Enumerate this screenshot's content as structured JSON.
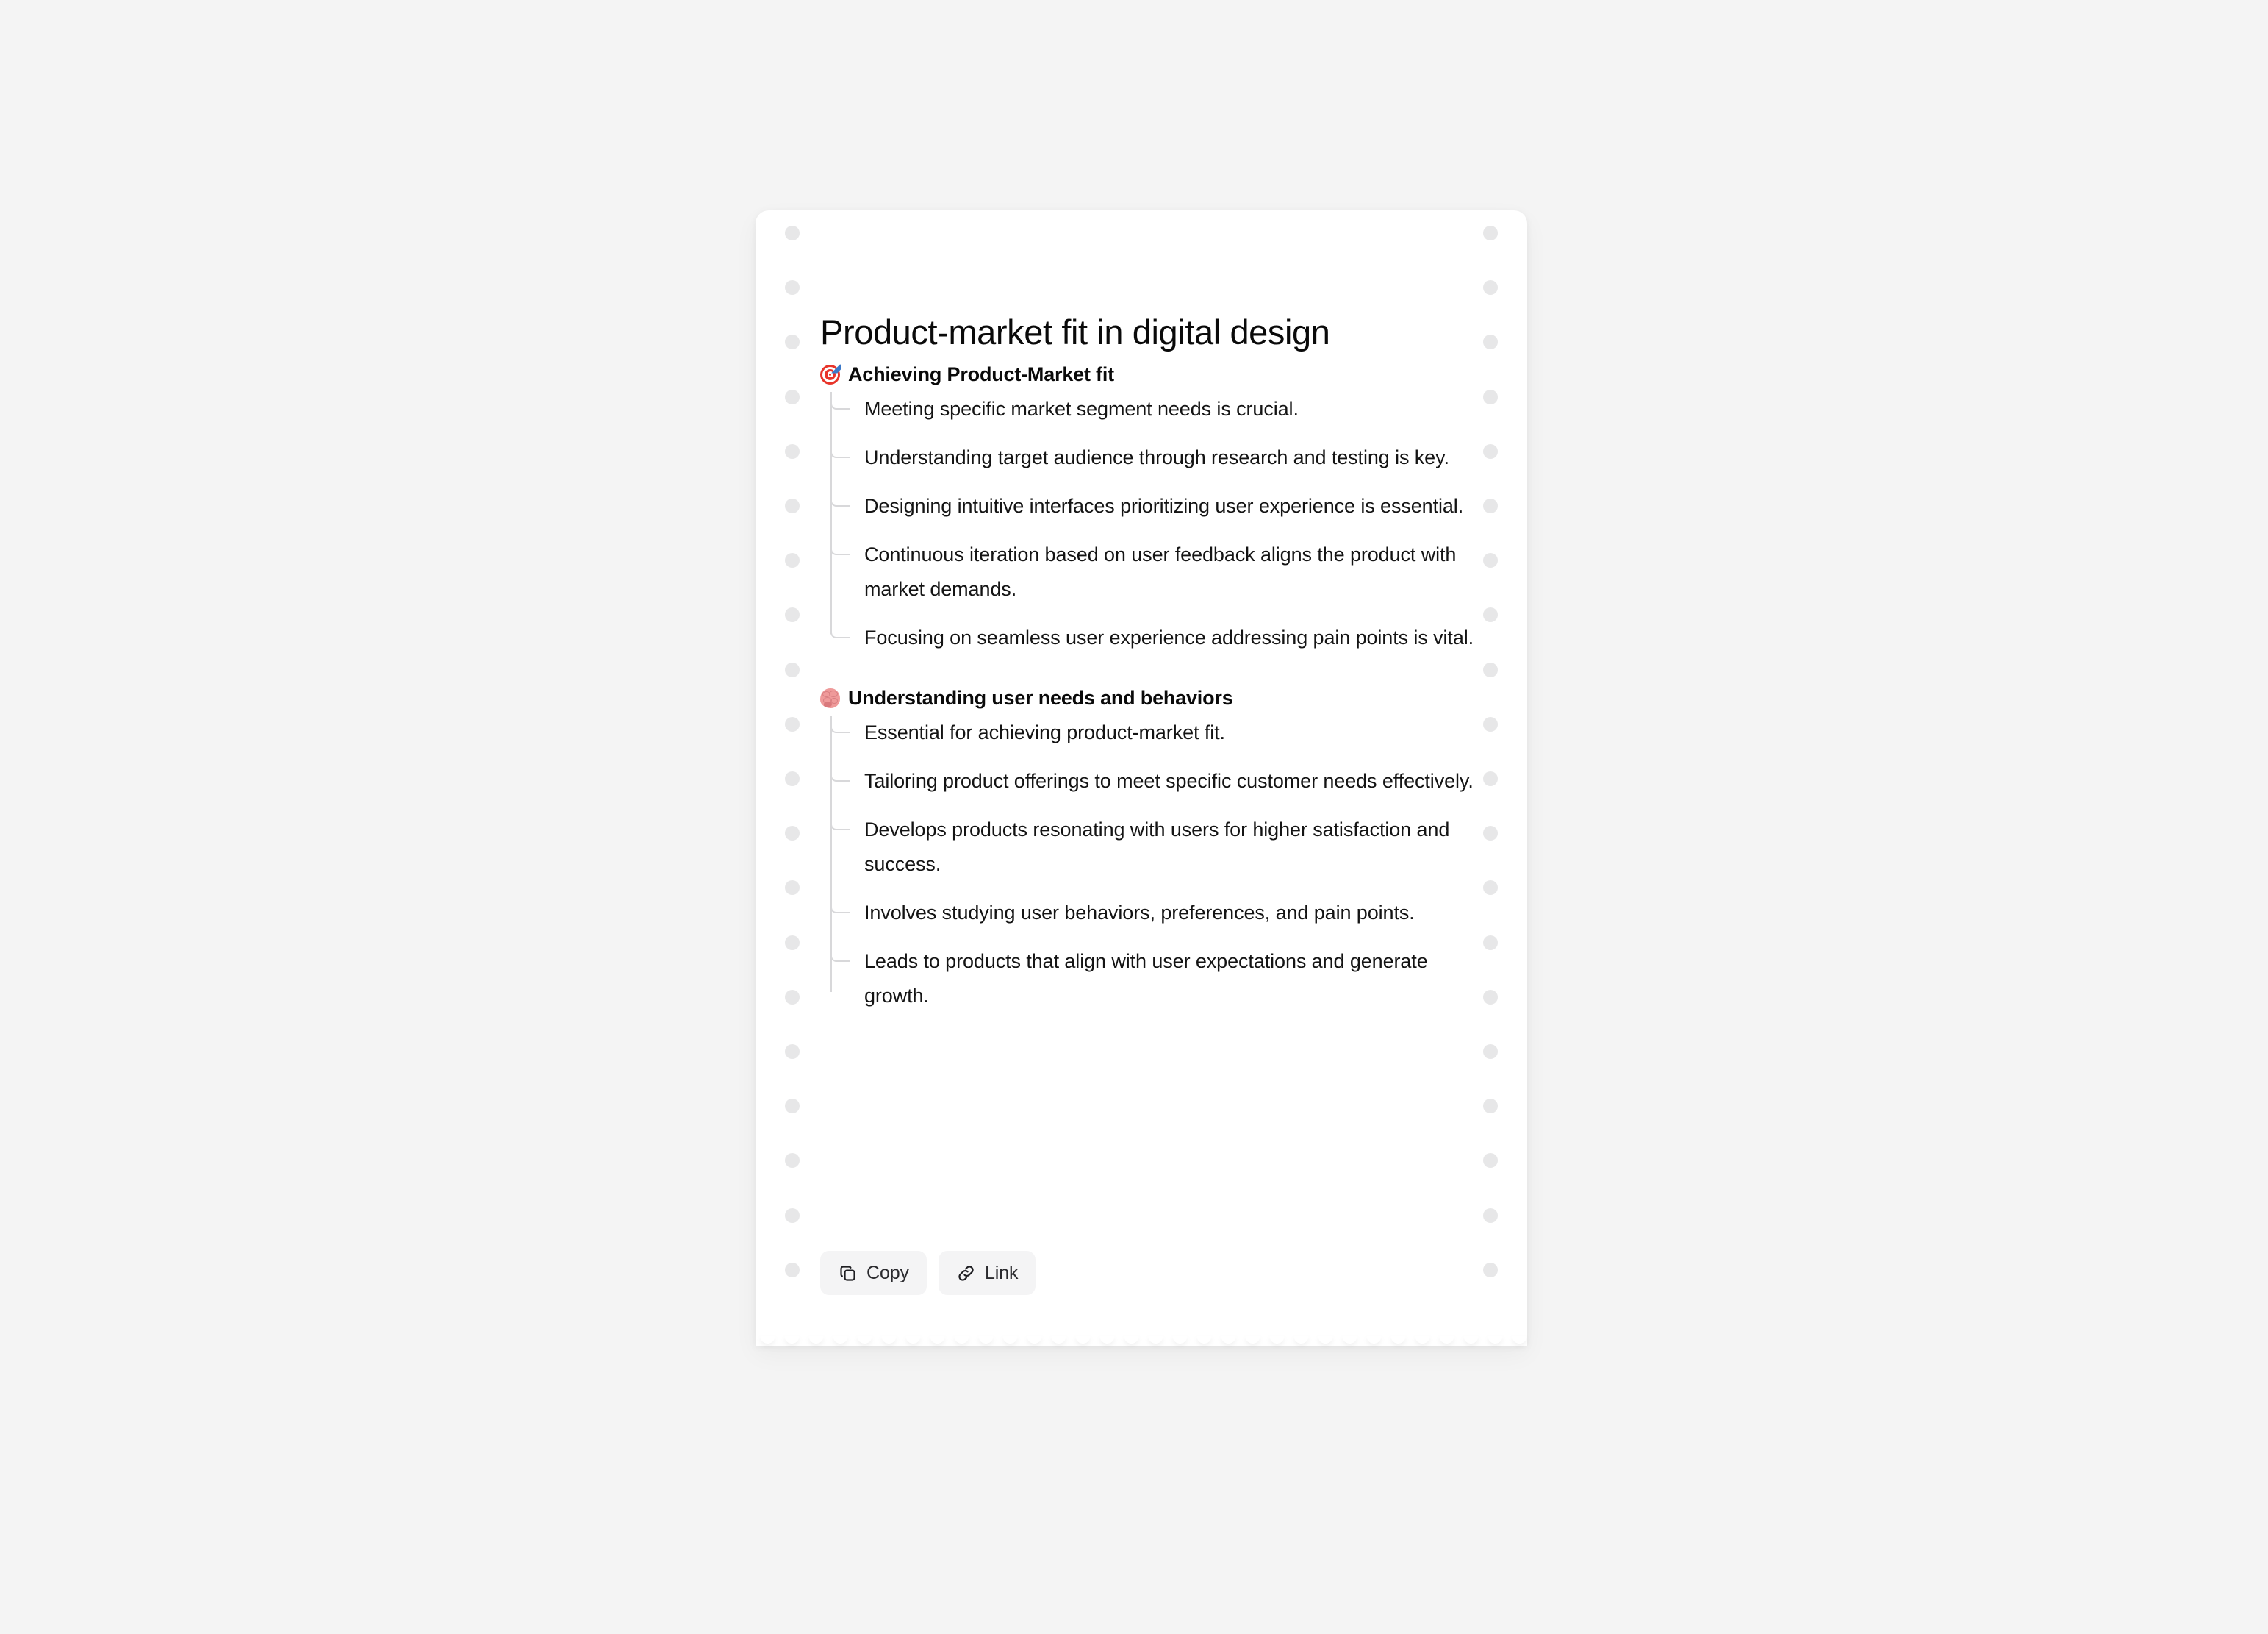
{
  "page": {
    "background_color": "#f4f4f4"
  },
  "card": {
    "background_color": "#ffffff",
    "perforation_dot_color": "#e7e7e8",
    "title": "Product-market fit in digital design"
  },
  "sections": [
    {
      "emoji_name": "dartboard-emoji",
      "emoji_char": "🎯",
      "heading": "Achieving Product-Market fit",
      "items": [
        "Meeting specific market segment needs is crucial.",
        "Understanding target audience through research and testing is key.",
        "Designing intuitive interfaces prioritizing user experience is essential.",
        "Continuous iteration based on user feedback aligns the product with market demands.",
        "Focusing on seamless user experience addressing pain points is vital."
      ]
    },
    {
      "emoji_name": "brain-emoji",
      "emoji_char": "🧠",
      "heading": "Understanding user needs and behaviors",
      "items": [
        "Essential for achieving product-market fit.",
        "Tailoring product offerings to meet specific customer needs effectively.",
        "Develops products resonating with users for higher satisfaction and success.",
        "Involves studying user behaviors, preferences, and pain points.",
        "Leads to products that align with user expectations and generate growth."
      ]
    }
  ],
  "footer": {
    "copy_label": "Copy",
    "link_label": "Link",
    "button_background": "#f4f4f5"
  }
}
